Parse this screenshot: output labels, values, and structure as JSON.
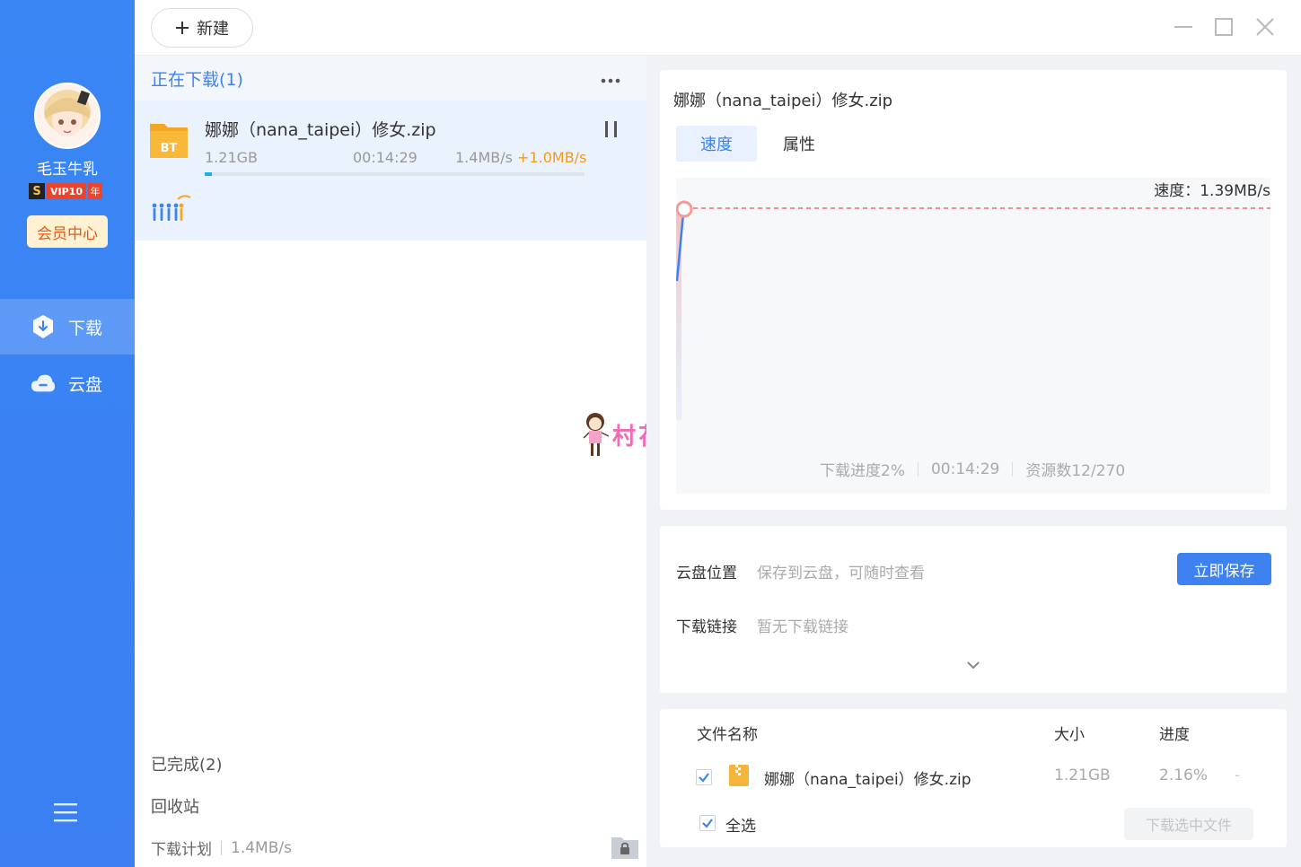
{
  "sidebar": {
    "username": "毛玉牛乳",
    "vip": {
      "s": "S",
      "level": "VIP10",
      "year": "年"
    },
    "member_center": "会员中心",
    "nav": [
      {
        "label": "下载",
        "icon": "download-shield-icon",
        "active": true
      },
      {
        "label": "云盘",
        "icon": "cloud-icon",
        "active": false
      }
    ],
    "colors": {
      "bg": "#3a86f5",
      "member_bg": "#fff2d4",
      "member_text": "#e55b12"
    }
  },
  "topbar": {
    "new_label": "新建"
  },
  "downloads": {
    "section_title": "正在下载(1)",
    "task": {
      "name": "娜娜（nana_taipei）修女.zip",
      "icon_label": "BT",
      "size": "1.21GB",
      "time_left": "00:14:29",
      "speed": "1.4MB/s",
      "speed_bonus": "+1.0MB/s",
      "progress_pct": 2
    },
    "completed": "已完成(2)",
    "recycle": "回收站",
    "plan_label": "下载计划",
    "plan_speed": "1.4MB/s"
  },
  "detail": {
    "title": "娜娜（nana_taipei）修女.zip",
    "tabs": [
      "速度",
      "属性"
    ],
    "speed_readout": "速度：1.39MB/s",
    "stats": {
      "progress": "下载进度2%",
      "time": "00:14:29",
      "sources": "资源数12/270"
    },
    "cloud_location_label": "云盘位置",
    "cloud_location_value": "保存到云盘，可随时查看",
    "save_now": "立即保存",
    "download_link_label": "下载链接",
    "download_link_value": "暂无下载链接",
    "files": {
      "headers": {
        "name": "文件名称",
        "size": "大小",
        "progress": "进度"
      },
      "rows": [
        {
          "name": "娜娜（nana_taipei）修女.zip",
          "size": "1.21GB",
          "progress": "2.16%",
          "extra": "-",
          "checked": true
        }
      ],
      "select_all": "全选",
      "download_selected": "下载选中文件"
    }
  },
  "watermark": {
    "text": "村花论坛"
  }
}
